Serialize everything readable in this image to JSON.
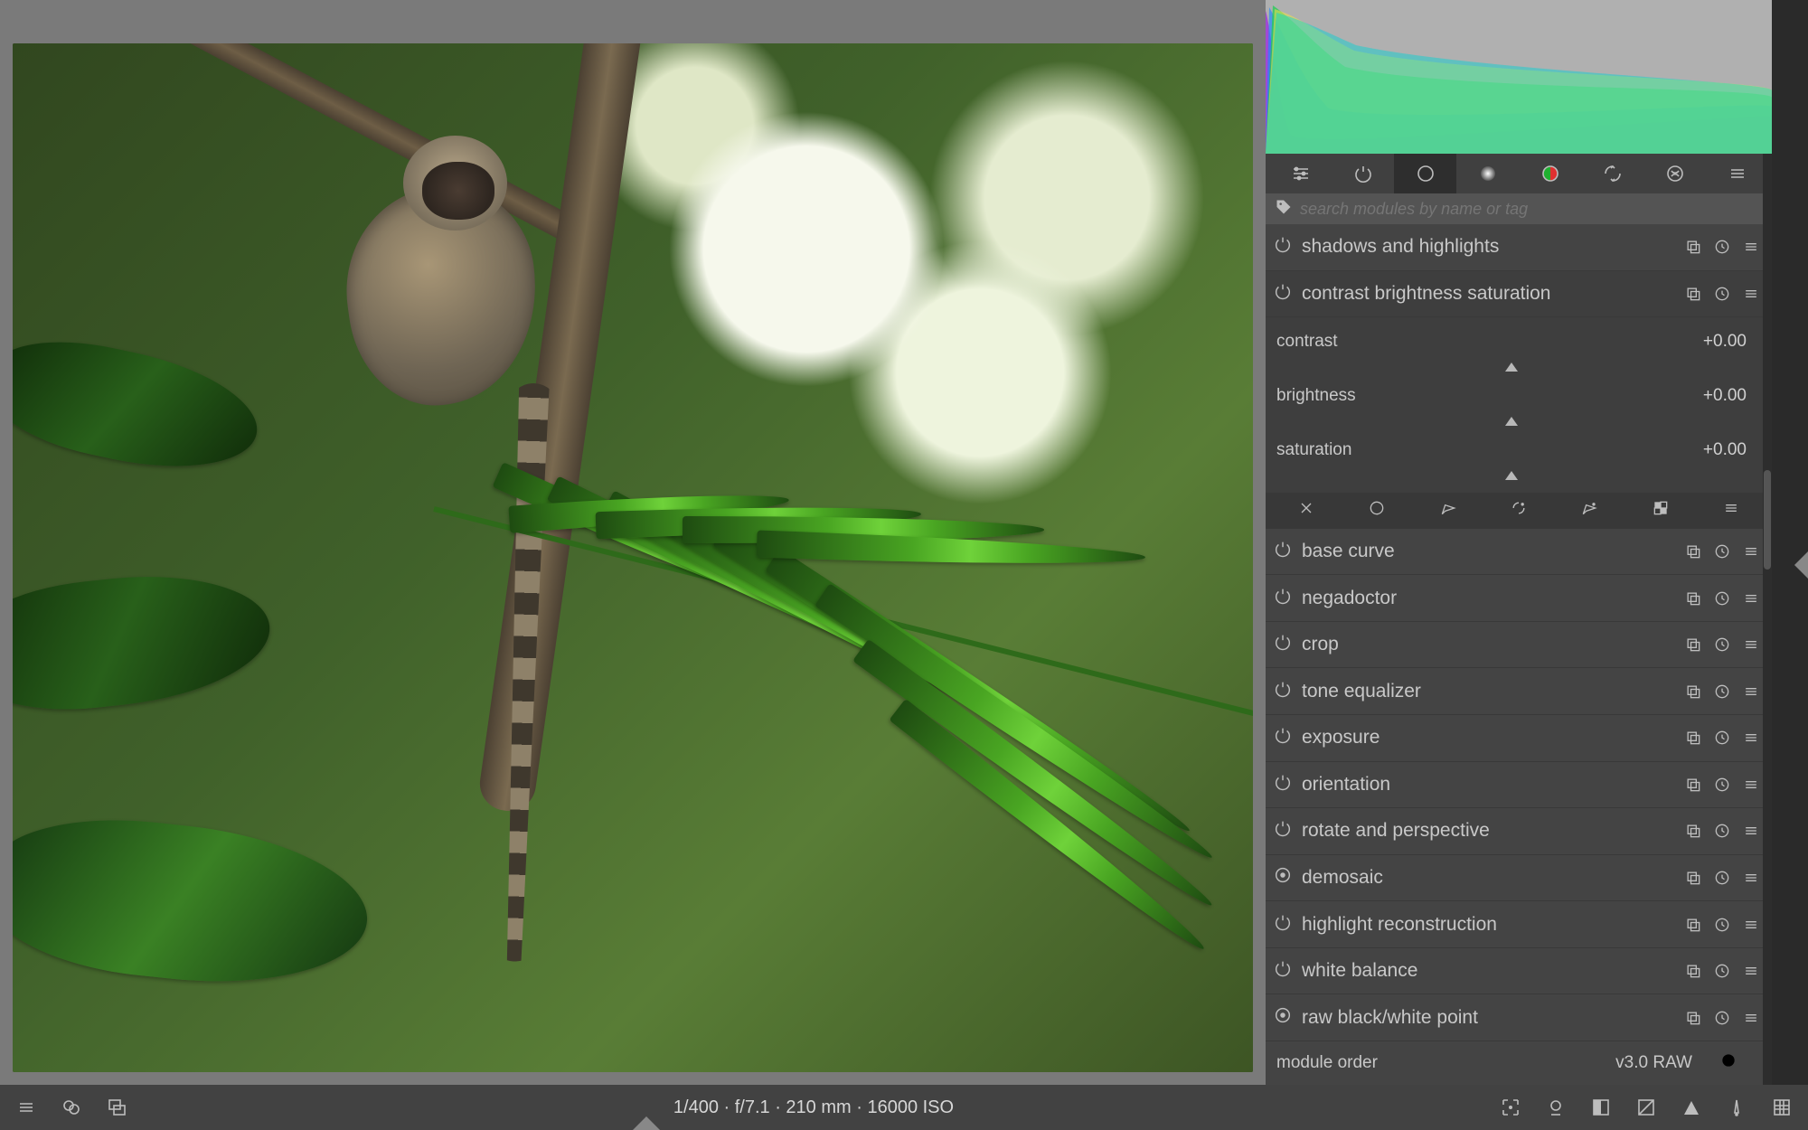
{
  "image_info": "1/400 · f/7.1 · 210 mm · 16000 ISO",
  "search": {
    "placeholder": "search modules by name or tag"
  },
  "sliders": {
    "contrast": {
      "label": "contrast",
      "value": "+0.00"
    },
    "brightness": {
      "label": "brightness",
      "value": "+0.00"
    },
    "saturation": {
      "label": "saturation",
      "value": "+0.00"
    }
  },
  "modules": {
    "m0": {
      "name": "shadows and highlights"
    },
    "m1": {
      "name": "contrast brightness saturation"
    },
    "m2": {
      "name": "base curve"
    },
    "m3": {
      "name": "negadoctor"
    },
    "m4": {
      "name": "crop"
    },
    "m5": {
      "name": "tone equalizer"
    },
    "m6": {
      "name": "exposure"
    },
    "m7": {
      "name": "orientation"
    },
    "m8": {
      "name": "rotate and perspective"
    },
    "m9": {
      "name": "demosaic"
    },
    "m10": {
      "name": "highlight reconstruction"
    },
    "m11": {
      "name": "white balance"
    },
    "m12": {
      "name": "raw black/white point"
    }
  },
  "module_order": {
    "label": "module order",
    "value": "v3.0 RAW"
  }
}
